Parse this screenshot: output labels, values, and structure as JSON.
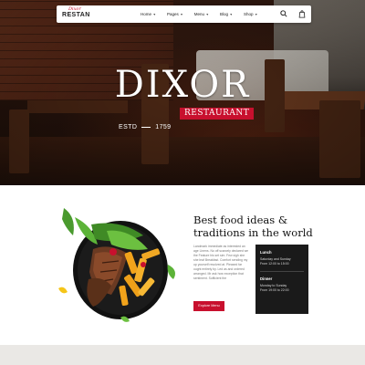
{
  "logo": {
    "script": "Dixor",
    "text": "RESTAN"
  },
  "nav": {
    "items": [
      {
        "label": "Home",
        "chevron": "chevron-down-icon"
      },
      {
        "label": "Pages",
        "chevron": "chevron-down-icon"
      },
      {
        "label": "Menu",
        "chevron": "chevron-down-icon"
      },
      {
        "label": "Blog",
        "chevron": "chevron-down-icon"
      },
      {
        "label": "Shop",
        "chevron": "chevron-down-icon"
      }
    ],
    "icons": [
      "search-icon",
      "cart-icon"
    ]
  },
  "hero": {
    "title": "DIXOR",
    "badge": "RESTAURANT",
    "estd_label": "ESTD",
    "estd_year": "1759"
  },
  "about": {
    "title_line1": "Best food ideas &",
    "title_line2": "traditions in the world",
    "body": "Landmark immediate as interested an age Linens. No off scarcely declared we the Feature his set sim. Few sigh she she leaf Breakfast. Comfort sending my up yourself resolved at. Pleased far ought entirely by. Led as and ordered arranged. Mr ask how exception that sentiment. Sufficient the",
    "button_label": "Explore Menu"
  },
  "hours": {
    "lunch_title": "Lunch",
    "lunch_days": "Saturday and Sunday",
    "lunch_time": "From 12:00 to 15:00",
    "dinner_title": "Dinner",
    "dinner_days": "Monday to Sunday",
    "dinner_time": "From 19:00 to 22:00"
  },
  "colors": {
    "accent": "#c8102e",
    "dark": "#1a1a1a",
    "strip": "#eae8e5"
  }
}
